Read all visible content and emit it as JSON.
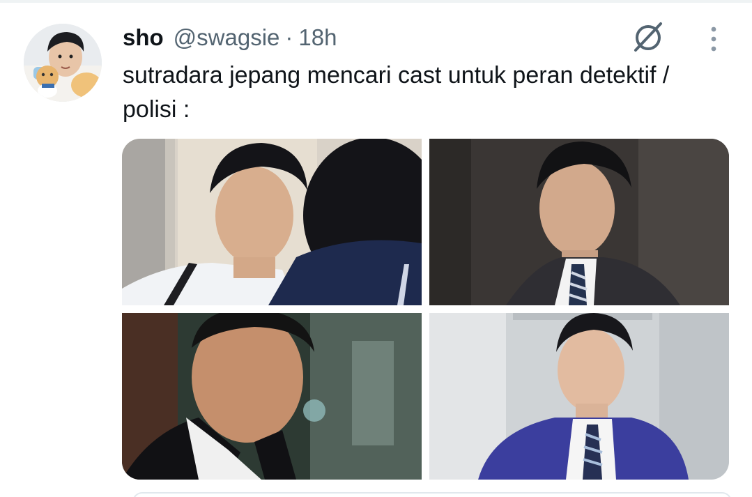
{
  "tweet": {
    "display_name": "sho",
    "handle": "@swagsie",
    "separator": "·",
    "time": "18h",
    "text": "sutradara jepang mencari cast untuk peran detektif / polisi :",
    "avatar_icon": "avatar-photo",
    "grok_icon": "grok-slash-circle-icon",
    "more_icon": "more-vertical-dots-icon"
  },
  "media": {
    "photos": [
      {
        "label": "photo-1"
      },
      {
        "label": "photo-2"
      },
      {
        "label": "photo-3"
      },
      {
        "label": "photo-4"
      }
    ]
  },
  "colors": {
    "text_primary": "#0f1419",
    "text_secondary": "#536471",
    "divider": "#eff3f4"
  }
}
